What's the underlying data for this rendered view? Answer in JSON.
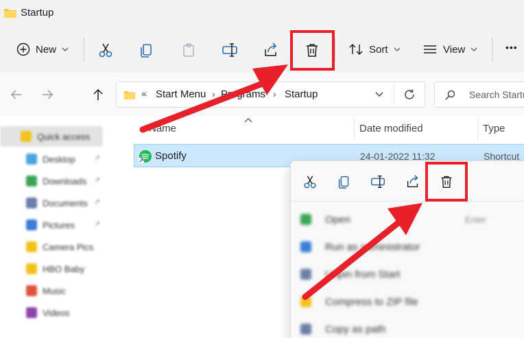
{
  "window": {
    "title": "Startup"
  },
  "toolbar": {
    "new_label": "New",
    "sort_label": "Sort",
    "view_label": "View",
    "more_label": "•••"
  },
  "address": {
    "overflow": "«",
    "crumbs": [
      "Start Menu",
      "Programs",
      "Startup"
    ],
    "search_placeholder": "Search Startup"
  },
  "nav_pane": {
    "items": [
      {
        "label": "Quick access",
        "color": "#f2c21b",
        "pinned": false
      },
      {
        "label": "Desktop",
        "color": "#4aa3df",
        "pinned": true
      },
      {
        "label": "Downloads",
        "color": "#3aa655",
        "pinned": true
      },
      {
        "label": "Documents",
        "color": "#6b7fa8",
        "pinned": true
      },
      {
        "label": "Pictures",
        "color": "#3b7dd8",
        "pinned": true
      },
      {
        "label": "Camera Pics",
        "color": "#f2c21b",
        "pinned": false
      },
      {
        "label": "HBO Baby",
        "color": "#f2c21b",
        "pinned": false
      },
      {
        "label": "Music",
        "color": "#e0523b",
        "pinned": false
      },
      {
        "label": "Videos",
        "color": "#8e44ad",
        "pinned": false
      }
    ]
  },
  "columns": {
    "name": "Name",
    "date_modified": "Date modified",
    "type": "Type"
  },
  "files": [
    {
      "name": "Spotify",
      "date_modified": "24-01-2022 11:32",
      "type": "Shortcut"
    }
  ],
  "context_menu": {
    "items": [
      {
        "label": "Open",
        "hint": "Enter",
        "color": "#3aa655"
      },
      {
        "label": "Run as administrator",
        "hint": "",
        "color": "#3b7dd8"
      },
      {
        "label": "Unpin from Start",
        "hint": "",
        "color": "#6b7fa8"
      },
      {
        "label": "Compress to ZIP file",
        "hint": "",
        "color": "#f2c21b"
      },
      {
        "label": "Copy as path",
        "hint": "",
        "color": "#6b7fa8"
      }
    ]
  },
  "colors": {
    "highlight": "#e8202a",
    "selection": "#cce8ff",
    "folder": "#f6c344",
    "spotify": "#1db954"
  }
}
